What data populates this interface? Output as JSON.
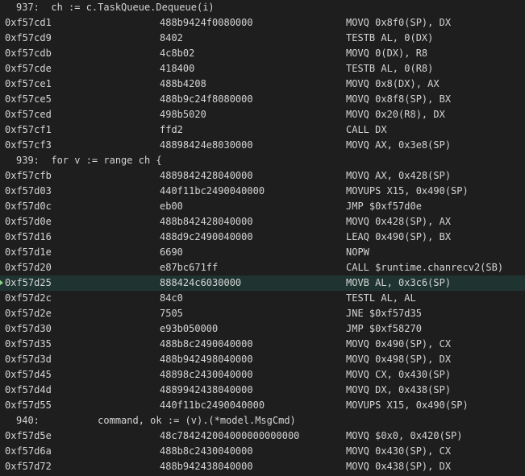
{
  "rows": [
    {
      "type": "src",
      "text": "937:  ch := c.TaskQueue.Dequeue(i)"
    },
    {
      "type": "asm",
      "addr": "0xf57cd1",
      "bytes": "488b9424f0080000",
      "instr": "MOVQ 0x8f0(SP), DX"
    },
    {
      "type": "asm",
      "addr": "0xf57cd9",
      "bytes": "8402",
      "instr": "TESTB AL, 0(DX)"
    },
    {
      "type": "asm",
      "addr": "0xf57cdb",
      "bytes": "4c8b02",
      "instr": "MOVQ 0(DX), R8"
    },
    {
      "type": "asm",
      "addr": "0xf57cde",
      "bytes": "418400",
      "instr": "TESTB AL, 0(R8)"
    },
    {
      "type": "asm",
      "addr": "0xf57ce1",
      "bytes": "488b4208",
      "instr": "MOVQ 0x8(DX), AX"
    },
    {
      "type": "asm",
      "addr": "0xf57ce5",
      "bytes": "488b9c24f8080000",
      "instr": "MOVQ 0x8f8(SP), BX"
    },
    {
      "type": "asm",
      "addr": "0xf57ced",
      "bytes": "498b5020",
      "instr": "MOVQ 0x20(R8), DX"
    },
    {
      "type": "asm",
      "addr": "0xf57cf1",
      "bytes": "ffd2",
      "instr": "CALL DX"
    },
    {
      "type": "asm",
      "addr": "0xf57cf3",
      "bytes": "48898424e8030000",
      "instr": "MOVQ AX, 0x3e8(SP)"
    },
    {
      "type": "src",
      "text": "939:  for v := range ch {"
    },
    {
      "type": "asm",
      "addr": "0xf57cfb",
      "bytes": "4889842428040000",
      "instr": "MOVQ AX, 0x428(SP)"
    },
    {
      "type": "asm",
      "addr": "0xf57d03",
      "bytes": "440f11bc2490040000",
      "instr": "MOVUPS X15, 0x490(SP)"
    },
    {
      "type": "asm",
      "addr": "0xf57d0c",
      "bytes": "eb00",
      "instr": "JMP $0xf57d0e"
    },
    {
      "type": "asm",
      "addr": "0xf57d0e",
      "bytes": "488b842428040000",
      "instr": "MOVQ 0x428(SP), AX"
    },
    {
      "type": "asm",
      "addr": "0xf57d16",
      "bytes": "488d9c2490040000",
      "instr": "LEAQ 0x490(SP), BX"
    },
    {
      "type": "asm",
      "addr": "0xf57d1e",
      "bytes": "6690",
      "instr": "NOPW"
    },
    {
      "type": "asm",
      "addr": "0xf57d20",
      "bytes": "e87bc671ff",
      "instr": "CALL $runtime.chanrecv2(SB)"
    },
    {
      "type": "asm",
      "addr": "0xf57d25",
      "bytes": "888424c6030000",
      "instr": "MOVB AL, 0x3c6(SP)",
      "current": true
    },
    {
      "type": "asm",
      "addr": "0xf57d2c",
      "bytes": "84c0",
      "instr": "TESTL AL, AL"
    },
    {
      "type": "asm",
      "addr": "0xf57d2e",
      "bytes": "7505",
      "instr": "JNE $0xf57d35"
    },
    {
      "type": "asm",
      "addr": "0xf57d30",
      "bytes": "e93b050000",
      "instr": "JMP $0xf58270"
    },
    {
      "type": "asm",
      "addr": "0xf57d35",
      "bytes": "488b8c2490040000",
      "instr": "MOVQ 0x490(SP), CX"
    },
    {
      "type": "asm",
      "addr": "0xf57d3d",
      "bytes": "488b942498040000",
      "instr": "MOVQ 0x498(SP), DX"
    },
    {
      "type": "asm",
      "addr": "0xf57d45",
      "bytes": "48898c2430040000",
      "instr": "MOVQ CX, 0x430(SP)"
    },
    {
      "type": "asm",
      "addr": "0xf57d4d",
      "bytes": "4889942438040000",
      "instr": "MOVQ DX, 0x438(SP)"
    },
    {
      "type": "asm",
      "addr": "0xf57d55",
      "bytes": "440f11bc2490040000",
      "instr": "MOVUPS X15, 0x490(SP)"
    },
    {
      "type": "src",
      "text": "940:          command, ok := (v).(*model.MsgCmd)"
    },
    {
      "type": "asm",
      "addr": "0xf57d5e",
      "bytes": "48c784242004000000000000",
      "instr": "MOVQ $0x0, 0x420(SP)"
    },
    {
      "type": "asm",
      "addr": "0xf57d6a",
      "bytes": "488b8c2430040000",
      "instr": "MOVQ 0x430(SP), CX"
    },
    {
      "type": "asm",
      "addr": "0xf57d72",
      "bytes": "488b942438040000",
      "instr": "MOVQ 0x438(SP), DX"
    }
  ]
}
